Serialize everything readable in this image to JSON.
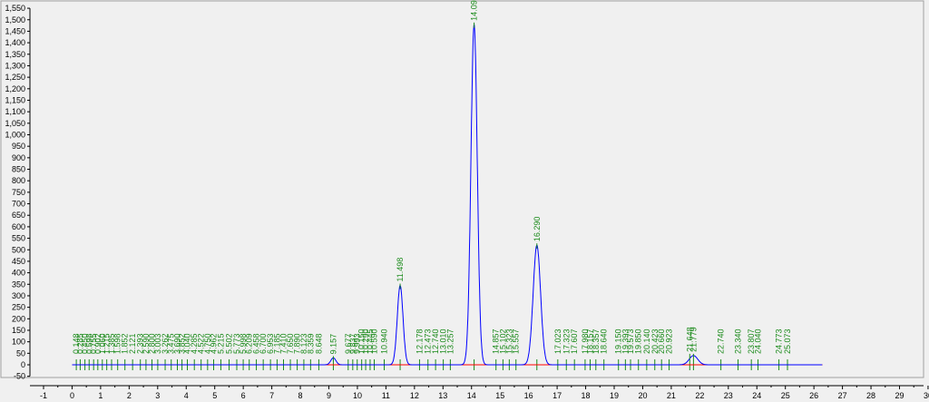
{
  "chart_data": {
    "type": "line",
    "title": "",
    "xlabel": "",
    "ylabel": "",
    "xlim": [
      -1,
      30
    ],
    "ylim": [
      -50,
      1550
    ],
    "x_ticks": [
      -1,
      0,
      1,
      2,
      3,
      4,
      5,
      6,
      7,
      8,
      9,
      10,
      11,
      12,
      13,
      14,
      15,
      16,
      17,
      18,
      19,
      20,
      21,
      22,
      23,
      24,
      25,
      26,
      27,
      28,
      29,
      30
    ],
    "y_ticks": [
      -50,
      0,
      50,
      100,
      150,
      200,
      250,
      300,
      350,
      400,
      450,
      500,
      550,
      600,
      650,
      700,
      750,
      800,
      850,
      900,
      950,
      1000,
      1050,
      1100,
      1150,
      1200,
      1250,
      1300,
      1350,
      1400,
      1450,
      1500,
      1550
    ],
    "y_tick_labels": [
      "-50",
      "0",
      "50",
      "100",
      "150",
      "200",
      "250",
      "300",
      "350",
      "400",
      "450",
      "500",
      "550",
      "600",
      "650",
      "700",
      "750",
      "800",
      "850",
      "900",
      "950",
      "1,000",
      "1,050",
      "1,100",
      "1,150",
      "1,200",
      "1,250",
      "1,300",
      "1,350",
      "1,400",
      "1,450",
      "1,500",
      "1,550"
    ],
    "grid": false,
    "colors": {
      "signal": "#0000ff",
      "baseline": "#ff0000",
      "labels": "#1a8a1a",
      "ticks": "#1a8a1a"
    },
    "signal_range": [
      0,
      26.3
    ],
    "peaks": [
      {
        "rt": 9.157,
        "height": 30,
        "width": 0.09,
        "label": "9.157"
      },
      {
        "rt": 11.498,
        "height": 345,
        "width": 0.1,
        "label": "11.498"
      },
      {
        "rt": 14.09,
        "height": 1480,
        "width": 0.11,
        "label": "14.090"
      },
      {
        "rt": 16.29,
        "height": 520,
        "width": 0.13,
        "label": "16.290"
      },
      {
        "rt": 21.779,
        "height": 40,
        "width": 0.15,
        "label": "21.779"
      },
      {
        "rt": 21.648,
        "height": 0,
        "width": 0,
        "label": "21.648"
      }
    ],
    "minor_peak_labels": [
      {
        "rt": 0.148,
        "label": "0.148"
      },
      {
        "rt": 0.285,
        "label": "0.285"
      },
      {
        "rt": 0.45,
        "label": "0.450"
      },
      {
        "rt": 0.598,
        "label": "0.598"
      },
      {
        "rt": 0.755,
        "label": "0.755"
      },
      {
        "rt": 0.902,
        "label": "0.902"
      },
      {
        "rt": 1.06,
        "label": "1.060"
      },
      {
        "rt": 1.215,
        "label": "1.215"
      },
      {
        "rt": 1.385,
        "label": "1.385"
      },
      {
        "rt": 1.598,
        "label": "1.598"
      },
      {
        "rt": 1.852,
        "label": "1.852"
      },
      {
        "rt": 2.121,
        "label": "2.121"
      },
      {
        "rt": 2.393,
        "label": "2.393"
      },
      {
        "rt": 2.59,
        "label": "2.590"
      },
      {
        "rt": 2.8,
        "label": "2.800"
      },
      {
        "rt": 3.003,
        "label": "3.003"
      },
      {
        "rt": 3.262,
        "label": "3.262"
      },
      {
        "rt": 3.475,
        "label": "3.475"
      },
      {
        "rt": 3.69,
        "label": "3.690"
      },
      {
        "rt": 3.852,
        "label": "3.852"
      },
      {
        "rt": 4.04,
        "label": "4.040"
      },
      {
        "rt": 4.285,
        "label": "4.285"
      },
      {
        "rt": 4.522,
        "label": "4.522"
      },
      {
        "rt": 4.75,
        "label": "4.750"
      },
      {
        "rt": 4.962,
        "label": "4.962"
      },
      {
        "rt": 5.215,
        "label": "5.215"
      },
      {
        "rt": 5.502,
        "label": "5.502"
      },
      {
        "rt": 5.773,
        "label": "5.773"
      },
      {
        "rt": 5.998,
        "label": "5.998"
      },
      {
        "rt": 6.209,
        "label": "6.209"
      },
      {
        "rt": 6.458,
        "label": "6.458"
      },
      {
        "rt": 6.7,
        "label": "6.700"
      },
      {
        "rt": 6.953,
        "label": "6.953"
      },
      {
        "rt": 7.185,
        "label": "7.185"
      },
      {
        "rt": 7.41,
        "label": "7.410"
      },
      {
        "rt": 7.65,
        "label": "7.650"
      },
      {
        "rt": 7.89,
        "label": "7.890"
      },
      {
        "rt": 8.123,
        "label": "8.123"
      },
      {
        "rt": 8.359,
        "label": "8.359"
      },
      {
        "rt": 8.648,
        "label": "8.648"
      },
      {
        "rt": 9.677,
        "label": "9.677"
      },
      {
        "rt": 9.837,
        "label": "9.837"
      },
      {
        "rt": 9.993,
        "label": "9.993"
      },
      {
        "rt": 10.15,
        "label": "10.150"
      },
      {
        "rt": 10.29,
        "label": "10.290"
      },
      {
        "rt": 10.445,
        "label": "10.445"
      },
      {
        "rt": 10.59,
        "label": "10.590"
      },
      {
        "rt": 10.94,
        "label": "10.940"
      },
      {
        "rt": 12.178,
        "label": "12.178"
      },
      {
        "rt": 12.473,
        "label": "12.473"
      },
      {
        "rt": 12.74,
        "label": "12.740"
      },
      {
        "rt": 13.01,
        "label": "13.010"
      },
      {
        "rt": 13.257,
        "label": "13.257"
      },
      {
        "rt": 14.857,
        "label": "14.857"
      },
      {
        "rt": 15.102,
        "label": "15.102"
      },
      {
        "rt": 15.323,
        "label": "15.323"
      },
      {
        "rt": 15.557,
        "label": "15.557"
      },
      {
        "rt": 17.023,
        "label": "17.023"
      },
      {
        "rt": 17.323,
        "label": "17.323"
      },
      {
        "rt": 17.607,
        "label": "17.607"
      },
      {
        "rt": 17.98,
        "label": "17.980"
      },
      {
        "rt": 18.157,
        "label": "18.157"
      },
      {
        "rt": 18.357,
        "label": "18.357"
      },
      {
        "rt": 18.64,
        "label": "18.640"
      },
      {
        "rt": 19.15,
        "label": "19.150"
      },
      {
        "rt": 19.393,
        "label": "19.393"
      },
      {
        "rt": 19.573,
        "label": "19.573"
      },
      {
        "rt": 19.85,
        "label": "19.850"
      },
      {
        "rt": 20.14,
        "label": "20.140"
      },
      {
        "rt": 20.423,
        "label": "20.423"
      },
      {
        "rt": 20.66,
        "label": "20.660"
      },
      {
        "rt": 20.923,
        "label": "20.923"
      },
      {
        "rt": 22.74,
        "label": "22.740"
      },
      {
        "rt": 23.34,
        "label": "23.340"
      },
      {
        "rt": 23.807,
        "label": "23.807"
      },
      {
        "rt": 24.04,
        "label": "24.040"
      },
      {
        "rt": 24.773,
        "label": "24.773"
      },
      {
        "rt": 25.073,
        "label": "25.073"
      }
    ]
  }
}
